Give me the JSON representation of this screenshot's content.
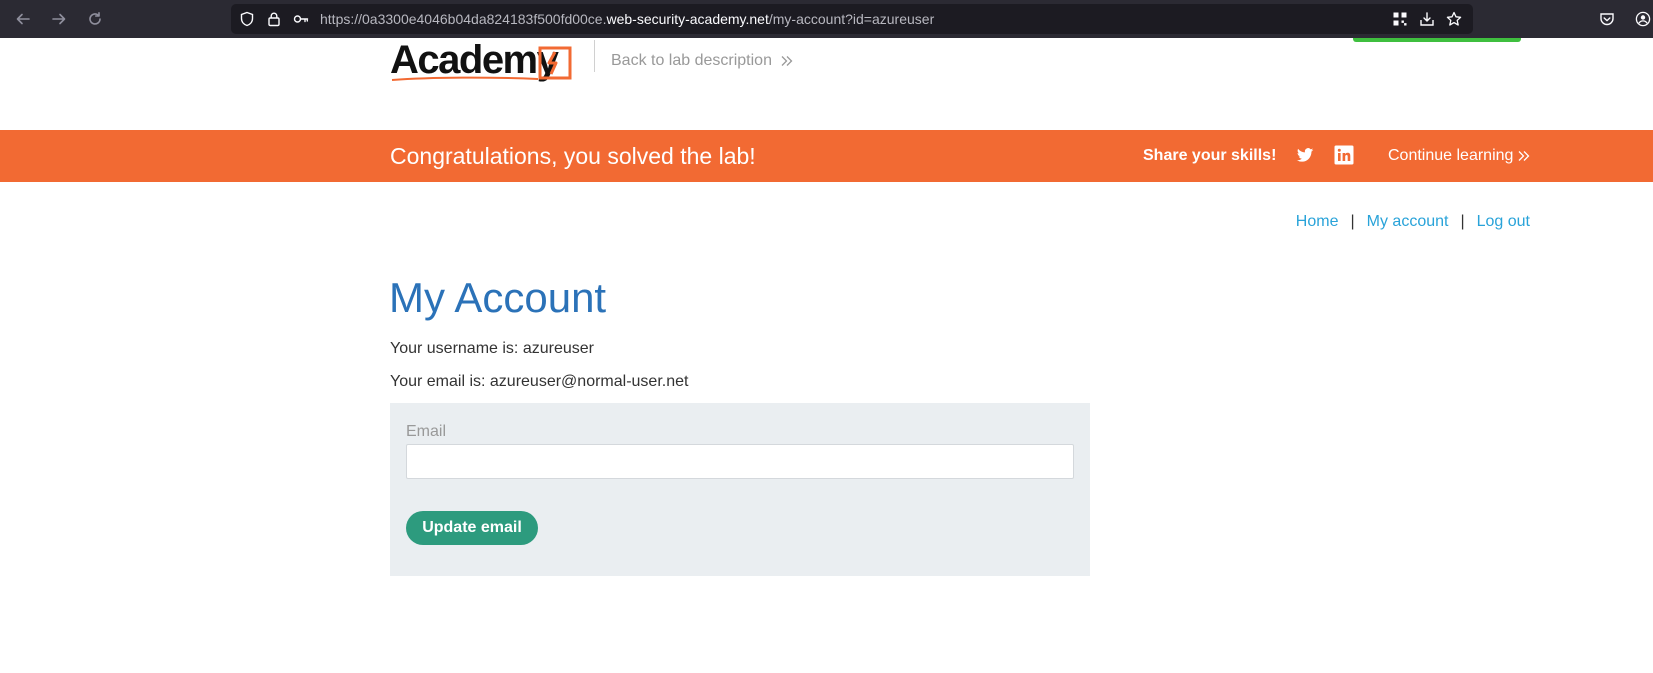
{
  "browser": {
    "url_prefix": "https://0a3300e4046b04da824183f500fd00ce.",
    "url_host": "web-security-academy.net",
    "url_path": "/my-account?id=azureuser"
  },
  "header": {
    "logo_text": "Academy",
    "back_link": "Back to lab description"
  },
  "banner": {
    "title": "Congratulations, you solved the lab!",
    "share_label": "Share your skills!",
    "continue_label": "Continue learning",
    "background_color": "#f26a33"
  },
  "topnav": {
    "home": "Home",
    "separator": "|",
    "my_account": "My account",
    "log_out": "Log out"
  },
  "main": {
    "title": "My Account",
    "username_line": "Your username is: azureuser",
    "email_line": "Your email is: azureuser@normal-user.net",
    "form": {
      "email_label": "Email",
      "email_value": "",
      "submit_label": "Update email"
    }
  },
  "colors": {
    "accent_blue": "#2b72b8",
    "link_blue": "#29a3d9",
    "button_green": "#2d9b7e"
  }
}
